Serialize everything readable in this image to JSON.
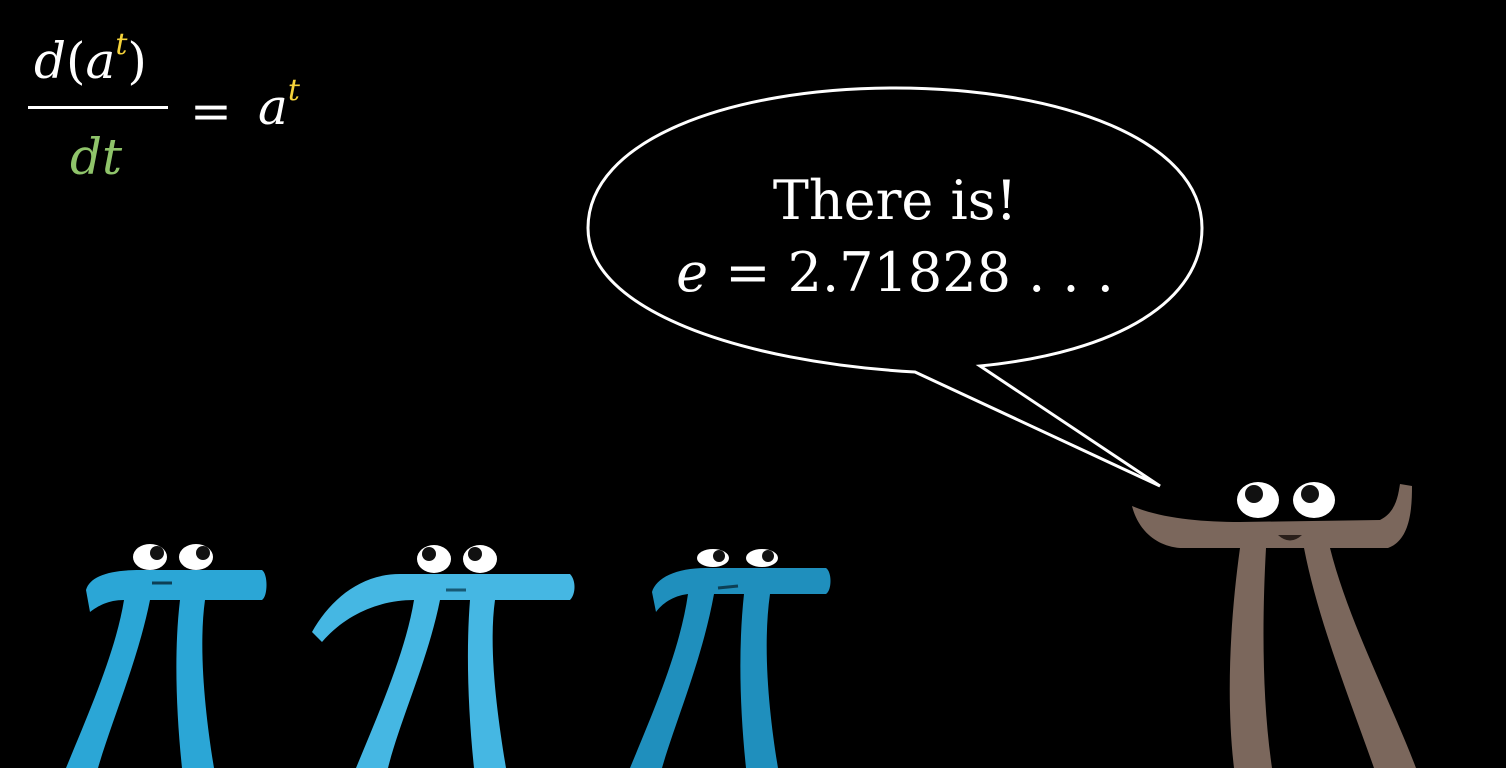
{
  "equation": {
    "numerator_d": "d",
    "numerator_open": "(",
    "numerator_a": "a",
    "numerator_exp": "t",
    "numerator_close": ")",
    "denominator": "dt",
    "equals": "=",
    "rhs_base": "a",
    "rhs_exp": "t",
    "colors": {
      "text": "#ffffff",
      "exponent": "#f5d33a",
      "denominator": "#8fc46a"
    }
  },
  "speech_bubble": {
    "line1": "There is!",
    "line2_var": "e",
    "line2_rest": " = 2.71828 . . ."
  },
  "characters": [
    {
      "name": "pi-creature-blue-1",
      "color": "#2ba6d6"
    },
    {
      "name": "pi-creature-blue-2",
      "color": "#45b7e3"
    },
    {
      "name": "pi-creature-blue-3",
      "color": "#1f8fbd"
    },
    {
      "name": "pi-creature-brown",
      "color": "#7b675c"
    }
  ],
  "colors": {
    "background": "#000000",
    "bubble_stroke": "#ffffff"
  }
}
